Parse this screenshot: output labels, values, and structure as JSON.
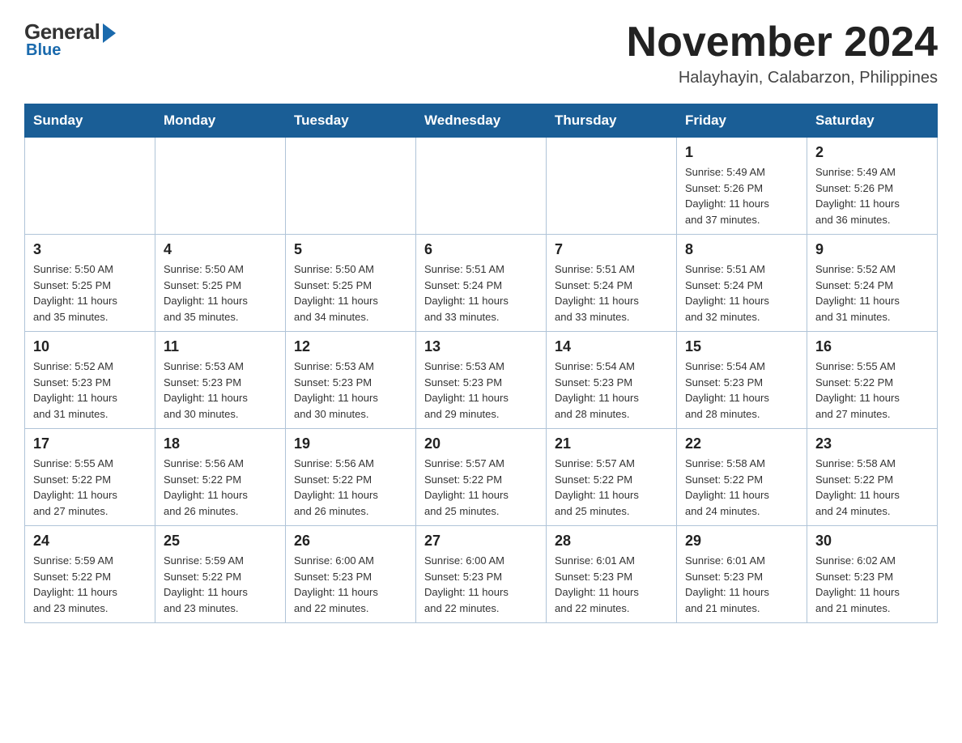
{
  "logo": {
    "general": "General",
    "blue": "Blue"
  },
  "title": "November 2024",
  "subtitle": "Halayhayin, Calabarzon, Philippines",
  "weekdays": [
    "Sunday",
    "Monday",
    "Tuesday",
    "Wednesday",
    "Thursday",
    "Friday",
    "Saturday"
  ],
  "weeks": [
    [
      {
        "day": "",
        "info": ""
      },
      {
        "day": "",
        "info": ""
      },
      {
        "day": "",
        "info": ""
      },
      {
        "day": "",
        "info": ""
      },
      {
        "day": "",
        "info": ""
      },
      {
        "day": "1",
        "info": "Sunrise: 5:49 AM\nSunset: 5:26 PM\nDaylight: 11 hours\nand 37 minutes."
      },
      {
        "day": "2",
        "info": "Sunrise: 5:49 AM\nSunset: 5:26 PM\nDaylight: 11 hours\nand 36 minutes."
      }
    ],
    [
      {
        "day": "3",
        "info": "Sunrise: 5:50 AM\nSunset: 5:25 PM\nDaylight: 11 hours\nand 35 minutes."
      },
      {
        "day": "4",
        "info": "Sunrise: 5:50 AM\nSunset: 5:25 PM\nDaylight: 11 hours\nand 35 minutes."
      },
      {
        "day": "5",
        "info": "Sunrise: 5:50 AM\nSunset: 5:25 PM\nDaylight: 11 hours\nand 34 minutes."
      },
      {
        "day": "6",
        "info": "Sunrise: 5:51 AM\nSunset: 5:24 PM\nDaylight: 11 hours\nand 33 minutes."
      },
      {
        "day": "7",
        "info": "Sunrise: 5:51 AM\nSunset: 5:24 PM\nDaylight: 11 hours\nand 33 minutes."
      },
      {
        "day": "8",
        "info": "Sunrise: 5:51 AM\nSunset: 5:24 PM\nDaylight: 11 hours\nand 32 minutes."
      },
      {
        "day": "9",
        "info": "Sunrise: 5:52 AM\nSunset: 5:24 PM\nDaylight: 11 hours\nand 31 minutes."
      }
    ],
    [
      {
        "day": "10",
        "info": "Sunrise: 5:52 AM\nSunset: 5:23 PM\nDaylight: 11 hours\nand 31 minutes."
      },
      {
        "day": "11",
        "info": "Sunrise: 5:53 AM\nSunset: 5:23 PM\nDaylight: 11 hours\nand 30 minutes."
      },
      {
        "day": "12",
        "info": "Sunrise: 5:53 AM\nSunset: 5:23 PM\nDaylight: 11 hours\nand 30 minutes."
      },
      {
        "day": "13",
        "info": "Sunrise: 5:53 AM\nSunset: 5:23 PM\nDaylight: 11 hours\nand 29 minutes."
      },
      {
        "day": "14",
        "info": "Sunrise: 5:54 AM\nSunset: 5:23 PM\nDaylight: 11 hours\nand 28 minutes."
      },
      {
        "day": "15",
        "info": "Sunrise: 5:54 AM\nSunset: 5:23 PM\nDaylight: 11 hours\nand 28 minutes."
      },
      {
        "day": "16",
        "info": "Sunrise: 5:55 AM\nSunset: 5:22 PM\nDaylight: 11 hours\nand 27 minutes."
      }
    ],
    [
      {
        "day": "17",
        "info": "Sunrise: 5:55 AM\nSunset: 5:22 PM\nDaylight: 11 hours\nand 27 minutes."
      },
      {
        "day": "18",
        "info": "Sunrise: 5:56 AM\nSunset: 5:22 PM\nDaylight: 11 hours\nand 26 minutes."
      },
      {
        "day": "19",
        "info": "Sunrise: 5:56 AM\nSunset: 5:22 PM\nDaylight: 11 hours\nand 26 minutes."
      },
      {
        "day": "20",
        "info": "Sunrise: 5:57 AM\nSunset: 5:22 PM\nDaylight: 11 hours\nand 25 minutes."
      },
      {
        "day": "21",
        "info": "Sunrise: 5:57 AM\nSunset: 5:22 PM\nDaylight: 11 hours\nand 25 minutes."
      },
      {
        "day": "22",
        "info": "Sunrise: 5:58 AM\nSunset: 5:22 PM\nDaylight: 11 hours\nand 24 minutes."
      },
      {
        "day": "23",
        "info": "Sunrise: 5:58 AM\nSunset: 5:22 PM\nDaylight: 11 hours\nand 24 minutes."
      }
    ],
    [
      {
        "day": "24",
        "info": "Sunrise: 5:59 AM\nSunset: 5:22 PM\nDaylight: 11 hours\nand 23 minutes."
      },
      {
        "day": "25",
        "info": "Sunrise: 5:59 AM\nSunset: 5:22 PM\nDaylight: 11 hours\nand 23 minutes."
      },
      {
        "day": "26",
        "info": "Sunrise: 6:00 AM\nSunset: 5:23 PM\nDaylight: 11 hours\nand 22 minutes."
      },
      {
        "day": "27",
        "info": "Sunrise: 6:00 AM\nSunset: 5:23 PM\nDaylight: 11 hours\nand 22 minutes."
      },
      {
        "day": "28",
        "info": "Sunrise: 6:01 AM\nSunset: 5:23 PM\nDaylight: 11 hours\nand 22 minutes."
      },
      {
        "day": "29",
        "info": "Sunrise: 6:01 AM\nSunset: 5:23 PM\nDaylight: 11 hours\nand 21 minutes."
      },
      {
        "day": "30",
        "info": "Sunrise: 6:02 AM\nSunset: 5:23 PM\nDaylight: 11 hours\nand 21 minutes."
      }
    ]
  ]
}
